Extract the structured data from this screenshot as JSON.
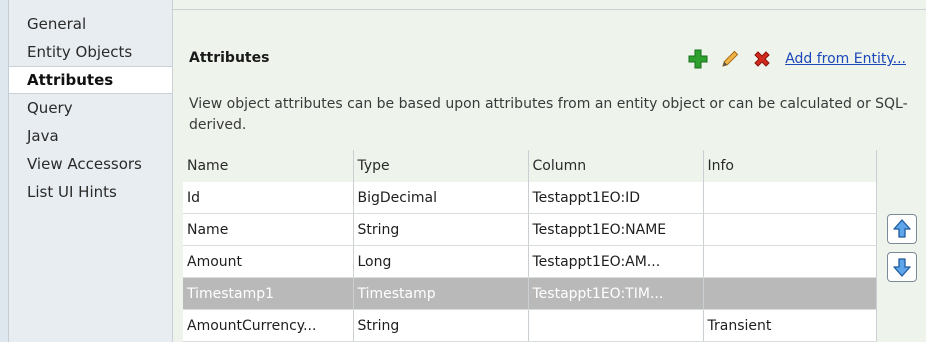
{
  "sidebar": {
    "items": [
      {
        "label": "General",
        "active": false
      },
      {
        "label": "Entity Objects",
        "active": false
      },
      {
        "label": "Attributes",
        "active": true
      },
      {
        "label": "Query",
        "active": false
      },
      {
        "label": "Java",
        "active": false
      },
      {
        "label": "View Accessors",
        "active": false
      },
      {
        "label": "List UI Hints",
        "active": false
      }
    ]
  },
  "main": {
    "title": "Attributes",
    "toolbar": {
      "add_icon": "plus-icon",
      "edit_icon": "pencil-icon",
      "delete_icon": "delete-x-icon",
      "add_from_entity_label": "Add from Entity..."
    },
    "description": "View object attributes can be based upon attributes from an entity object or can be calculated or SQL-derived.",
    "table": {
      "headers": [
        "Name",
        "Type",
        "Column",
        "Info"
      ],
      "rows": [
        {
          "name": "Id",
          "type": "BigDecimal",
          "column": "Testappt1EO:ID",
          "info": "",
          "selected": false
        },
        {
          "name": "Name",
          "type": "String",
          "column": "Testappt1EO:NAME",
          "info": "",
          "selected": false
        },
        {
          "name": "Amount",
          "type": "Long",
          "column": "Testappt1EO:AM...",
          "info": "",
          "selected": false
        },
        {
          "name": "Timestamp1",
          "type": "Timestamp",
          "column": "Testappt1EO:TIM...",
          "info": "",
          "selected": true
        },
        {
          "name": "AmountCurrency...",
          "type": "String",
          "column": "",
          "info": "Transient",
          "selected": false
        }
      ]
    },
    "move_up_icon": "arrow-up-icon",
    "move_down_icon": "arrow-down-icon"
  },
  "colors": {
    "accent_link": "#1b47b8",
    "add_green": "#2ea02e",
    "delete_red": "#d22a1e",
    "edit_orange": "#e39b2d",
    "selected_row": "#b9b9b9",
    "panel_bg": "#eef4ec",
    "sidebar_bg": "#e8edf1"
  }
}
